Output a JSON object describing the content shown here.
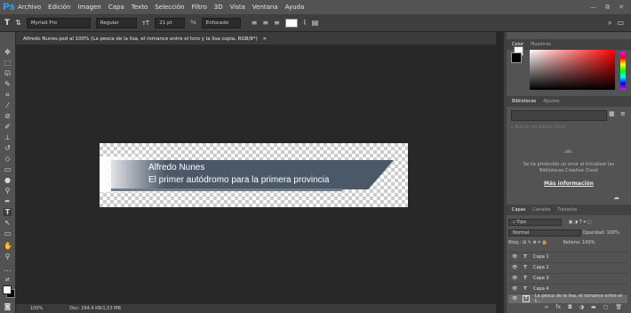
{
  "app": {
    "logo": "Ps",
    "menu": [
      "Archivo",
      "Edición",
      "Imagen",
      "Capa",
      "Texto",
      "Selección",
      "Filtro",
      "3D",
      "Vista",
      "Ventana",
      "Ayuda"
    ],
    "window_buttons": [
      "—",
      "⧉",
      "✕"
    ]
  },
  "options": {
    "font_family": "Myriad Pro",
    "font_style": "Regular",
    "font_size": "21 pt",
    "aa_label": "ªa",
    "antialias": "Enfocado"
  },
  "document": {
    "tab_title": "Alfredo Nunes.psd al 100% (La pesca de la lisa, el romance entre el toro y la lisa copia, RGB/8*)",
    "tab_close": "×",
    "banner_line1": "Alfredo Nunes",
    "banner_line2": "El primer autódromo para la primera provincia"
  },
  "status": {
    "zoom": "100%",
    "doc_size": "Doc: 294,4 KB/1,53 MB"
  },
  "panels": {
    "color_tabs": [
      "Color",
      "Muestras"
    ],
    "library_tabs": [
      "Bibliotecas",
      "Ajustes"
    ],
    "library_search_placeholder": "Buscar en Adobe Stock",
    "cloud_error": "Se ha producido un error al inicializar las Bibliotecas Creative Cloud",
    "cloud_link": "Más información",
    "layers_tabs": [
      "Capas",
      "Canales",
      "Trazados"
    ],
    "layer_filter": "Tipo",
    "blend_mode": "Normal",
    "opacity_label": "Opacidad:",
    "opacity_value": "100%",
    "lock_label": "Bloq.:",
    "fill_label": "Relleno:",
    "fill_value": "100%",
    "layers": [
      {
        "name": "Capa 1"
      },
      {
        "name": "Capa 2"
      },
      {
        "name": "Capa 3"
      },
      {
        "name": "Capa 4"
      },
      {
        "name": "La pesca de la lisa, el romance entre el t..."
      }
    ]
  },
  "colors": {
    "ps_blue": "#31a8ff",
    "banner": "#4a5868"
  }
}
